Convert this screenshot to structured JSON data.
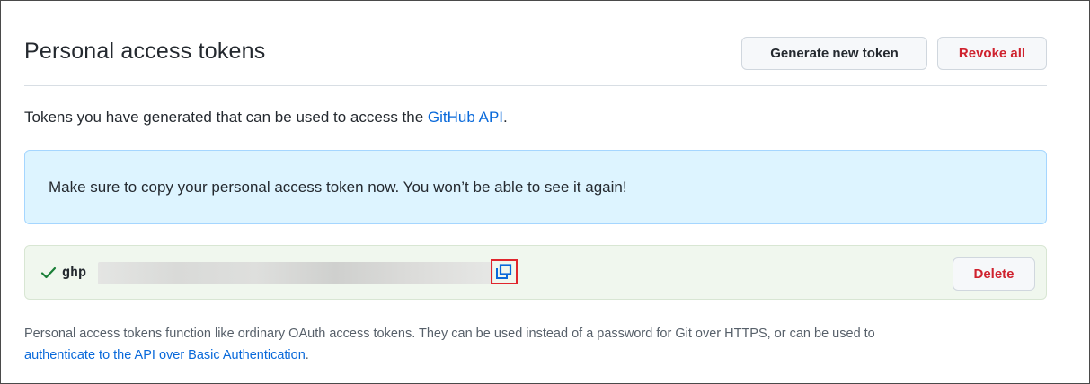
{
  "header": {
    "title": "Personal access tokens",
    "generate_label": "Generate new token",
    "revoke_label": "Revoke all"
  },
  "description": {
    "prefix": "Tokens you have generated that can be used to access the ",
    "link": "GitHub API",
    "suffix": "."
  },
  "flash": {
    "message": "Make sure to copy your personal access token now. You won’t be able to see it again!"
  },
  "token": {
    "prefix": "ghp",
    "status_icon": "check-icon",
    "copy_icon": "copy-icon",
    "delete_label": "Delete"
  },
  "footnote": {
    "text": "Personal access tokens function like ordinary OAuth access tokens. They can be used instead of a password for Git over HTTPS, or can be used to",
    "link": "authenticate to the API over Basic Authentication",
    "suffix": "."
  },
  "colors": {
    "danger": "#cf222e",
    "link": "#0969da",
    "info_bg": "#ddf4ff",
    "success_bg": "#f0f7ee",
    "highlight_border": "#e0262d"
  }
}
